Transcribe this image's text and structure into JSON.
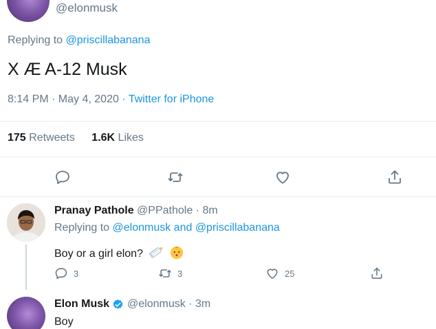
{
  "top_tweet": {
    "handle": "@elonmusk",
    "replying_prefix": "Replying to ",
    "replying_to": "@priscillabanana",
    "text": "X Æ A-12 Musk",
    "time_date": "8:14 PM · May 4, 2020 · ",
    "source": "Twitter for iPhone",
    "retweets_count": "175",
    "retweets_label": " Retweets",
    "likes_count": "1.6K",
    "likes_label": " Likes",
    "actions": [
      "reply-icon",
      "retweet-icon",
      "like-icon",
      "share-icon"
    ]
  },
  "reply_tweet": {
    "name": "Pranay Pathole",
    "handle": " @PPathole · 8m",
    "replying_prefix": "Replying to ",
    "replying_to_1": "@elonmusk",
    "and_label": " and ",
    "replying_to_2": "@priscillabanana",
    "text": "Boy or a girl elon?",
    "emojis": [
      "baby-bottle-icon",
      "baby-face-icon"
    ],
    "reply_count": "3",
    "retweet_count": "3",
    "like_count": "25"
  },
  "third_tweet": {
    "name": "Elon Musk",
    "handle": "@elonmusk · 3m",
    "text": "Boy"
  },
  "colors": {
    "link": "#1b95e0",
    "secondary_text": "#657786",
    "primary_text": "#14171a",
    "divider": "#e6ecf0"
  }
}
